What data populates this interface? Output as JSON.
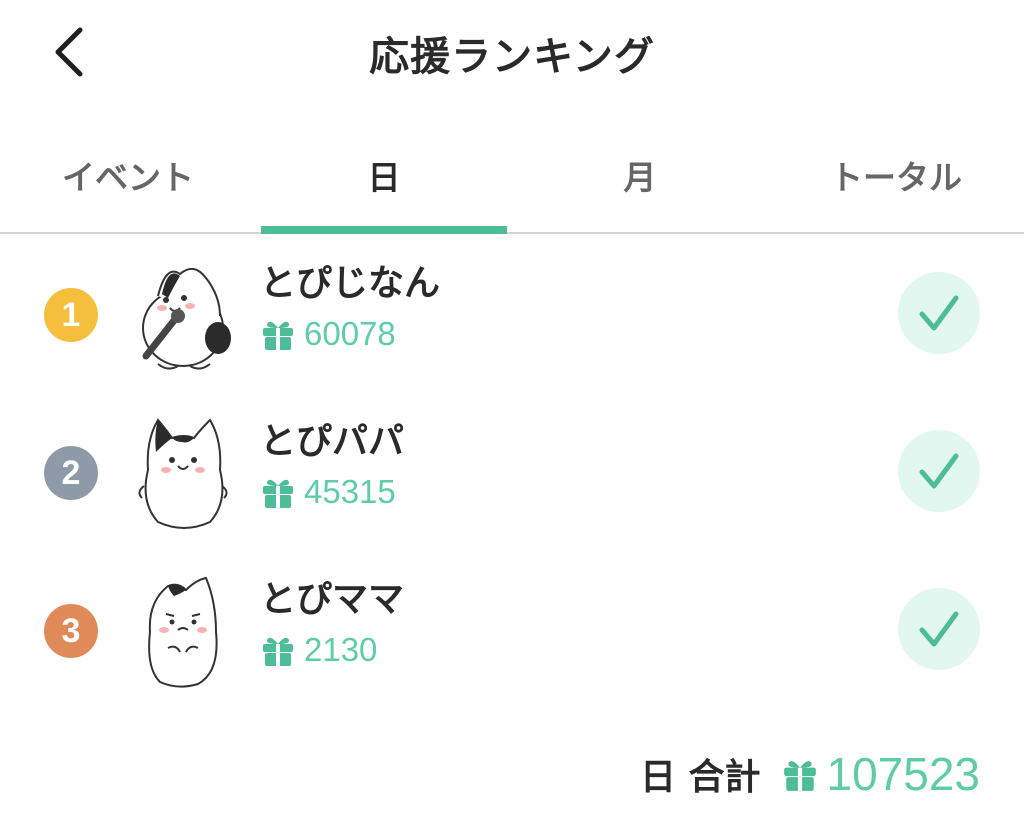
{
  "header": {
    "title": "応援ランキング",
    "back_icon": "chevron-left-icon"
  },
  "tabs": [
    {
      "label": "イベント",
      "active": false
    },
    {
      "label": "日",
      "active": true
    },
    {
      "label": "月",
      "active": false
    },
    {
      "label": "トータル",
      "active": false
    }
  ],
  "colors": {
    "accent": "#4dbd98",
    "score_text": "#5fcca8",
    "rank_1": "#f5be3d",
    "rank_2": "#8f9aa9",
    "rank_3": "#e08a5a",
    "check_bg": "#e2f7f0"
  },
  "ranking": [
    {
      "rank": "1",
      "name": "とぴじなん",
      "score": "60078",
      "avatar": "cat-singing-avatar",
      "checked": true
    },
    {
      "rank": "2",
      "name": "とぴパパ",
      "score": "45315",
      "avatar": "cat-standing-avatar",
      "checked": true
    },
    {
      "rank": "3",
      "name": "とぴママ",
      "score": "2130",
      "avatar": "cat-worried-avatar",
      "checked": true
    }
  ],
  "total": {
    "label": "日 合計",
    "value": "107523",
    "icon": "gift-icon"
  }
}
